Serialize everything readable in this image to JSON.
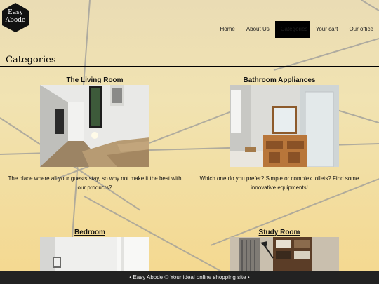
{
  "brand": {
    "name_line1": "Easy",
    "name_line2": "Abode"
  },
  "nav": {
    "items": [
      {
        "label": "Home"
      },
      {
        "label": "About Us"
      },
      {
        "label": "Categories"
      },
      {
        "label": "Your cart"
      },
      {
        "label": "Our office"
      }
    ],
    "active": "Categories"
  },
  "page": {
    "title": "Categories"
  },
  "categories": [
    {
      "title": "The Living Room",
      "description": "The place where all your guests stay, so why not make it the best with our products?"
    },
    {
      "title": "Bathroom Appliances",
      "description": "Which one do you prefer? Simple or complex toilets? Find some innovative equipments!"
    },
    {
      "title": "Bedroom",
      "description": ""
    },
    {
      "title": "Study Room",
      "description": ""
    }
  ],
  "footer": {
    "text": "• Easy Abode © Your ideal online shopping site •"
  }
}
